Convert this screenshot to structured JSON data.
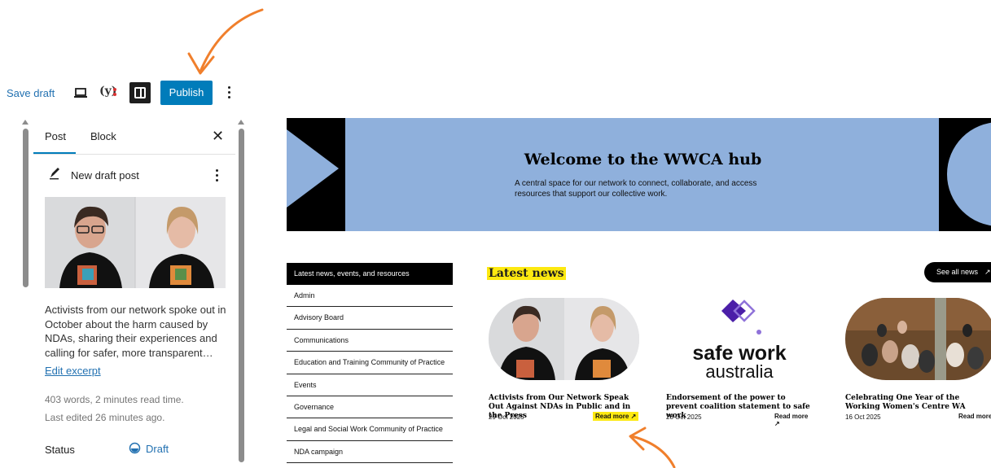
{
  "toolbar": {
    "save_draft": "Save draft",
    "publish": "Publish",
    "icons": [
      "preview-icon",
      "yoast-seo-icon",
      "settings-panel-icon",
      "more-options-icon"
    ]
  },
  "sidebar": {
    "tabs": [
      "Post",
      "Block"
    ],
    "post_title": "New draft post",
    "excerpt": "Activists from our network spoke out in October about the harm caused by NDAs, sharing their experiences and calling for safer, more transparent…",
    "edit_excerpt": "Edit excerpt",
    "read_time": "403 words, 2 minutes read time.",
    "last_edited": "Last edited 26 minutes ago.",
    "status_label": "Status",
    "status_value": "Draft"
  },
  "hero": {
    "title": "Welcome to the WWCA hub",
    "subtitle": "A central space for our network to connect, collaborate, and access resources that support our collective work."
  },
  "nav": {
    "heading": "Latest news, events, and resources",
    "items": [
      "Admin",
      "Advisory Board",
      "Communications",
      "Education and Training Community of Practice",
      "Events",
      "Governance",
      "Legal and Social Work Community of Practice",
      "NDA campaign"
    ]
  },
  "news": {
    "heading": "Latest news",
    "see_all": "See all news",
    "cards": [
      {
        "title": "Activists from Our Network Speak Out Against NDAs in Public and in the Press",
        "date": "29 Oct 2025",
        "read_more": "Read more"
      },
      {
        "title": "Endorsement of the power to prevent coalition statement to safe work",
        "date": "28 Oct 2025",
        "read_more": "Read more",
        "logo_line1": "safe work",
        "logo_line2": "australia"
      },
      {
        "title": "Celebrating One Year of the Working Women's Centre WA",
        "date": "16 Oct 2025",
        "read_more": "Read more"
      }
    ]
  },
  "colors": {
    "accent_blue": "#007cba",
    "hero_blue": "#8fb0dc",
    "highlight_yellow": "#fde910",
    "arrow_orange": "#f07f2c",
    "logo_purple": "#4b1fa8"
  }
}
